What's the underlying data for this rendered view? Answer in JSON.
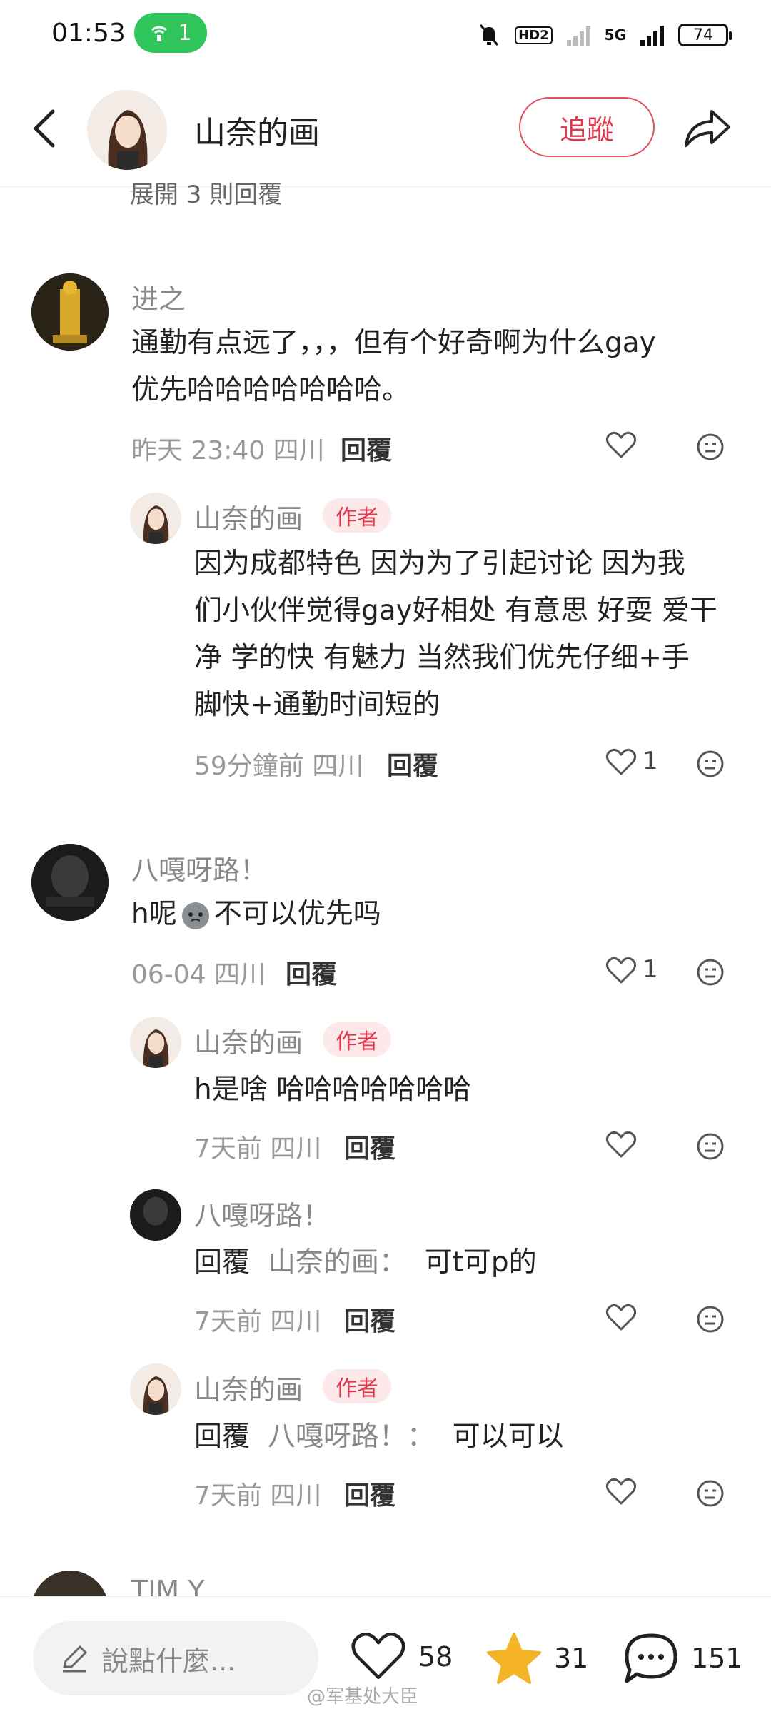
{
  "status_bar": {
    "time": "01:53",
    "hotspot_count": "1",
    "network": "5G",
    "battery": "74",
    "hd": "HD2"
  },
  "header": {
    "author_name": "山奈的画",
    "follow_label": "追蹤"
  },
  "expand_replies": "展開 3 則回覆",
  "author_tag": "作者",
  "reply_label": "回覆",
  "reply_prefix": "回覆",
  "comments": [
    {
      "user": "进之",
      "text_lines": [
        "通勤有点远了，，，但有个好奇啊为什么gay",
        "优先哈哈哈哈哈哈哈。"
      ],
      "meta": "昨天 23:40 四川",
      "likes": ""
    },
    {
      "user": "山奈的画",
      "text_lines": [
        "因为成都特色 因为为了引起讨论 因为我",
        "们小伙伴觉得gay好相处 有意思 好耍 爱干",
        "净 学的快 有魅力 当然我们优先仔细+手",
        "脚快+通勤时间短的"
      ],
      "meta": "59分鐘前 四川",
      "likes": "1"
    },
    {
      "user": "八嘎呀路！",
      "text": "h呢",
      "text_after": "不可以优先吗",
      "meta": "06-04 四川",
      "likes": "1"
    },
    {
      "user": "山奈的画",
      "text": "h是啥 哈哈哈哈哈哈哈",
      "meta": "7天前 四川",
      "likes": ""
    },
    {
      "user": "八嘎呀路！",
      "reply_to": "山奈的画：",
      "text": "可t可p的",
      "meta": "7天前 四川",
      "likes": ""
    },
    {
      "user": "山奈的画",
      "reply_to": "八嘎呀路！：",
      "text": "可以可以",
      "meta": "7天前 四川",
      "likes": ""
    },
    {
      "user": "TIM Y"
    }
  ],
  "bottom_bar": {
    "input_placeholder": "說點什麼...",
    "likes": "58",
    "stars": "31",
    "comments": "151"
  },
  "watermark": "@军基处大臣",
  "colors": {
    "accent": "#e0384d",
    "hotspot": "#2fc55b",
    "star": "#f5b427"
  }
}
